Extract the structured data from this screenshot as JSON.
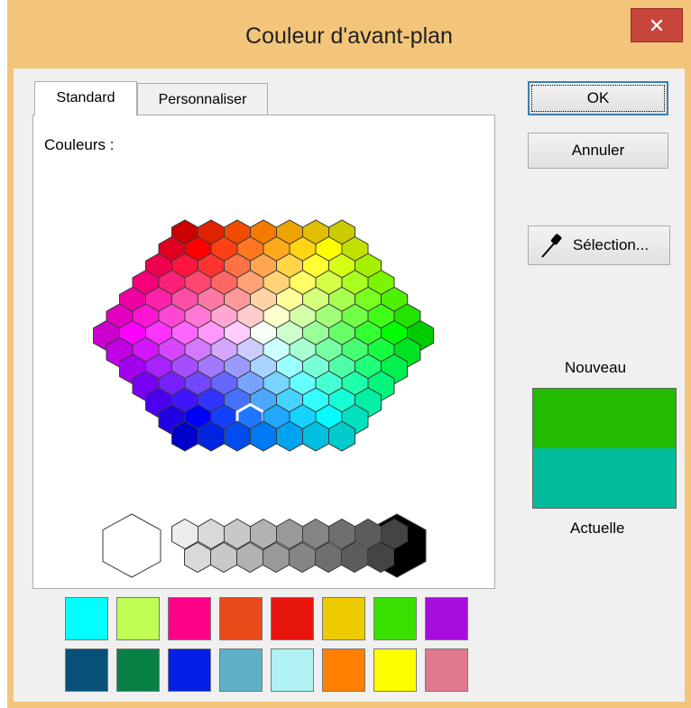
{
  "window": {
    "title": "Couleur d'avant-plan",
    "close_label": "✕"
  },
  "tabs": [
    {
      "label": "Standard",
      "active": true
    },
    {
      "label": "Personnaliser",
      "active": false
    }
  ],
  "labels": {
    "colors": "Couleurs :",
    "new": "Nouveau",
    "current": "Actuelle"
  },
  "buttons": {
    "ok": "OK",
    "cancel": "Annuler",
    "pick": "Sélection..."
  },
  "colors": {
    "new": "#22bb00",
    "current": "#00bb99",
    "window_frame": "#f2c57a",
    "close": "#c7463c"
  },
  "icons": {
    "close": "close-icon",
    "eyedropper": "eyedropper-icon"
  },
  "palette": {
    "selected": {
      "row": 11,
      "col": 3
    },
    "grays": [
      "#ffffff",
      "#ececec",
      "#d9d9d9",
      "#c8c8c8",
      "#b2b2b2",
      "#999999",
      "#858585",
      "#6f6f6f",
      "#5c5c5c",
      "#444444",
      "#2e2e2e",
      "#1b1b1b",
      "#000000"
    ]
  },
  "recent_colors": [
    [
      "#00ffff",
      "#bfff55",
      "#ff0088",
      "#e84b1a",
      "#e8140e",
      "#eecb00",
      "#3ae000",
      "#a60ddd"
    ],
    [
      "#06507a",
      "#078145",
      "#0420e5",
      "#5fb0c9",
      "#b0f1f3",
      "#ff7f00",
      "#ffff00",
      "#e0788e"
    ]
  ]
}
